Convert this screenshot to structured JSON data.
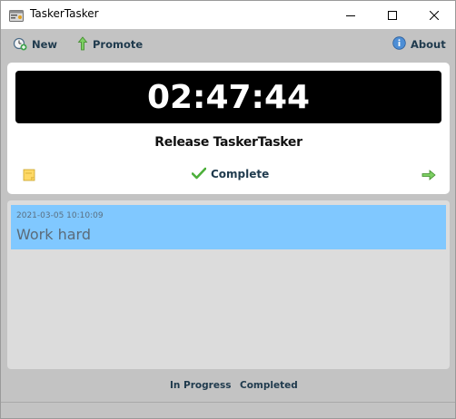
{
  "window": {
    "title": "TaskerTasker",
    "icon": "app-window-icon"
  },
  "toolbar": {
    "new_label": "New",
    "promote_label": "Promote",
    "about_label": "About"
  },
  "current_task": {
    "timer": "02:47:44",
    "title": "Release TaskerTasker",
    "complete_label": "Complete"
  },
  "log": {
    "items": [
      {
        "timestamp": "2021-03-05 10:10:09",
        "text": "Work hard"
      }
    ]
  },
  "tabs": {
    "in_progress": "In Progress",
    "completed": "Completed"
  },
  "colors": {
    "background": "#c3c3c3",
    "timer_bg": "#000000",
    "selected_item": "#80c8ff",
    "label_text": "#1f3a4d"
  }
}
